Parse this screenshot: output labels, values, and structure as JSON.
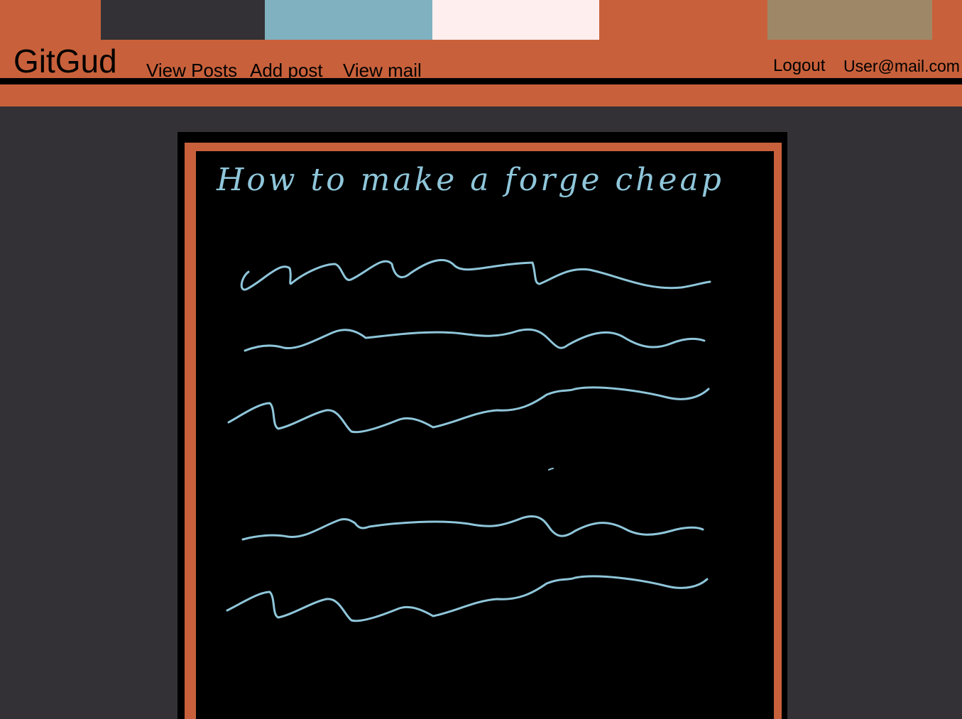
{
  "header": {
    "brand": "GitGud",
    "nav": {
      "view_posts": "View Posts",
      "add_post": "Add post",
      "view_mail": "View mail"
    },
    "logout": "Logout",
    "user_email": "User@mail.com"
  },
  "palette": {
    "accent": "#c8613b",
    "dark": "#333135",
    "light_blue": "#7fb1c0",
    "pink_white": "#feeeee",
    "tan": "#9e8767"
  },
  "post": {
    "title": "How to make a forge cheap",
    "body_placeholder_icon": "handwritten-scribble-lines"
  }
}
